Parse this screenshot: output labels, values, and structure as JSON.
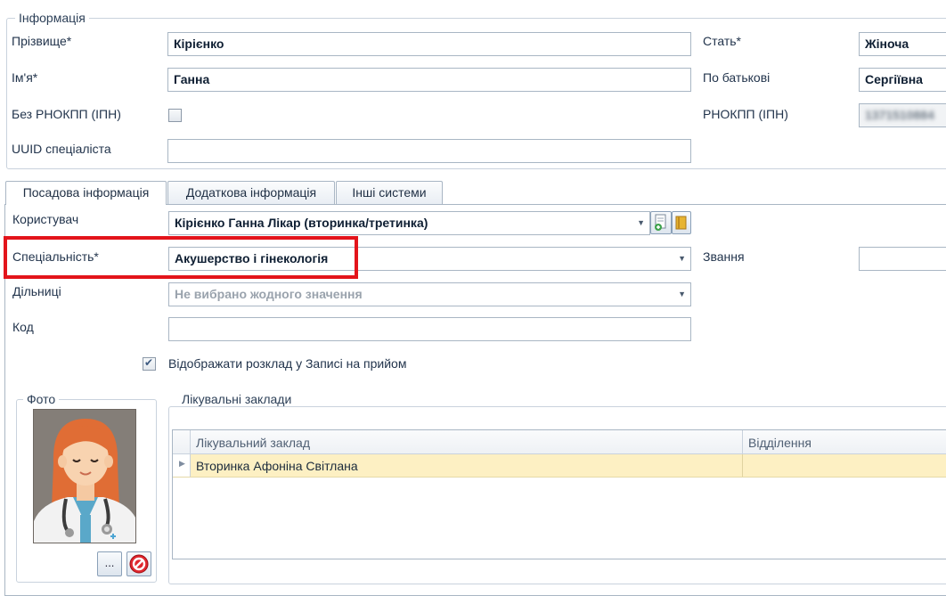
{
  "info": {
    "legend": "Інформація",
    "surname_label": "Прізвище*",
    "surname_value": "Кірієнко",
    "name_label": "Ім'я*",
    "name_value": "Ганна",
    "no_tax_label": "Без РНОКПП (ІПН)",
    "uuid_label": "UUID спеціаліста",
    "uuid_value": "",
    "sex_label": "Стать*",
    "sex_value": "Жіноча",
    "patronymic_label": "По батькові",
    "patronymic_value": "Сергіївна",
    "tax_label": "РНОКПП (ІПН)",
    "tax_value": "1371510884"
  },
  "tabs": [
    {
      "label": "Посадова інформація",
      "active": true
    },
    {
      "label": "Додаткова інформація",
      "active": false
    },
    {
      "label": "Інші системи",
      "active": false
    }
  ],
  "position": {
    "user_label": "Користувач",
    "user_value": "Кірієнко Ганна Лікар (вторинка/третинка)",
    "specialty_label": "Спеціальність*",
    "specialty_value": "Акушерство і гінекологія",
    "rank_label": "Звання",
    "rank_value": "",
    "districts_label": "Дільниці",
    "districts_placeholder": "Не вибрано жодного значення",
    "code_label": "Код",
    "code_value": "",
    "schedule_label": "Відображати розклад у Записі на прийом",
    "schedule_checked": true
  },
  "photo": {
    "legend": "Фото",
    "browse_label": "...",
    "avatar_icon": "female-doctor-icon",
    "delete_icon": "delete-icon"
  },
  "facilities": {
    "legend": "Лікувальні заклади",
    "columns": [
      "Лікувальний заклад",
      "Відділення"
    ],
    "rows": [
      {
        "facility": "Вторинка Афоніна Світлана",
        "department": ""
      }
    ]
  },
  "colors": {
    "highlight_box": "#e3141b",
    "selected_row": "#fdf0c3"
  }
}
